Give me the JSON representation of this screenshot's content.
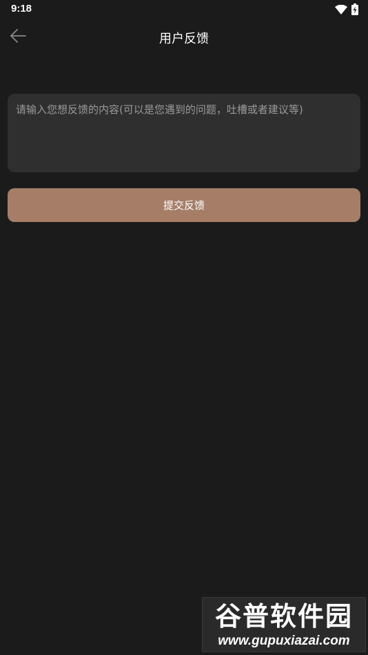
{
  "status_bar": {
    "time": "9:18",
    "icons": [
      "wifi-icon",
      "battery-charging-icon"
    ]
  },
  "app_bar": {
    "back_icon": "arrow-left-icon",
    "title": "用户反馈"
  },
  "feedback": {
    "value": "",
    "placeholder": "请输入您想反馈的内容(可以是您遇到的问题，吐槽或者建议等)"
  },
  "submit": {
    "label": "提交反馈"
  },
  "watermark": {
    "title": "谷普软件园",
    "url": "www.gupuxiazai.com"
  },
  "colors": {
    "background": "#1b1b1b",
    "input_background": "#2f2f2f",
    "accent": "#a67e68",
    "placeholder": "#9a9a9a"
  }
}
